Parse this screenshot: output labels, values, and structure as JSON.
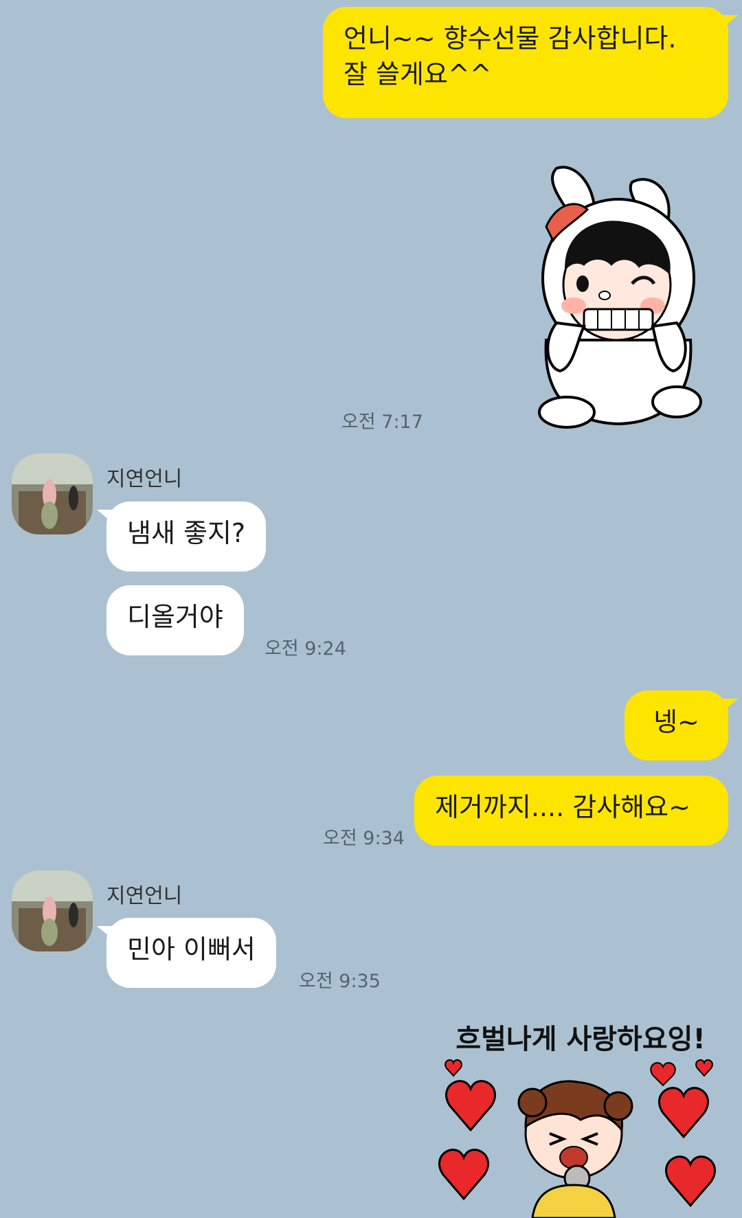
{
  "messages": {
    "m1": "언니~~  향수선물 감사합니다.",
    "m1b": "잘 쓸게요^^",
    "t1": "오전 7:17",
    "sender": "지연언니",
    "m2": "냄새 좋지?",
    "m3": "디올거야",
    "t2": "오전 9:24",
    "m4": "넹~",
    "m5": "제거까지.... 감사해요~",
    "t3": "오전 9:34",
    "m6": "민아 이뻐서",
    "t4": "오전 9:35"
  },
  "sticker2": {
    "text": "흐벌나게 사랑하요잉!"
  },
  "colors": {
    "background": "#abc1d1",
    "my_bubble": "#fee500",
    "other_bubble": "#ffffff"
  }
}
